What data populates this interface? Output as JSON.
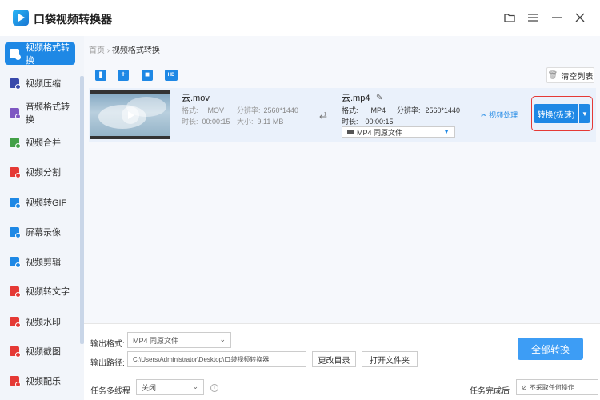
{
  "app": {
    "title": "口袋视频转换器"
  },
  "window_controls": {
    "folder": "folder-icon",
    "menu": "menu-icon",
    "minimize": "minimize-icon",
    "close": "close-icon"
  },
  "sidebar": {
    "items": [
      {
        "label": "视频格式转换",
        "color": "#1e88e5"
      },
      {
        "label": "视频压缩",
        "color": "#3949ab"
      },
      {
        "label": "音频格式转换",
        "color": "#7e57c2"
      },
      {
        "label": "视频合并",
        "color": "#43a047"
      },
      {
        "label": "视频分割",
        "color": "#e53935"
      },
      {
        "label": "视频转GIF",
        "color": "#1e88e5"
      },
      {
        "label": "屏幕录像",
        "color": "#1e88e5"
      },
      {
        "label": "视频剪辑",
        "color": "#1e88e5"
      },
      {
        "label": "视频转文字",
        "color": "#e53935"
      },
      {
        "label": "视频水印",
        "color": "#e53935"
      },
      {
        "label": "视频截图",
        "color": "#e53935"
      },
      {
        "label": "视频配乐",
        "color": "#e53935"
      }
    ]
  },
  "breadcrumb": {
    "home": "首页",
    "sep": "›",
    "current": "视频格式转换"
  },
  "toolbar": {
    "clear_label": "清空列表"
  },
  "file": {
    "source_name": "云.mov",
    "source_format_label": "格式:",
    "source_format": "MOV",
    "source_res_label": "分辨率:",
    "source_res": "2560*1440",
    "source_duration_label": "时长:",
    "source_duration": "00:00:15",
    "source_size_label": "大小:",
    "source_size": "9.11 MB",
    "target_name": "云.mp4",
    "target_format_label": "格式:",
    "target_format": "MP4",
    "target_res_label": "分辨率:",
    "target_res": "2560*1440",
    "target_duration_label": "时长:",
    "target_duration": "00:00:15",
    "target_preset": "MP4  同原文件",
    "process_label": "视频处理",
    "convert_label": "转换(极速)"
  },
  "bottom": {
    "output_format_label": "输出格式:",
    "output_format_value": "MP4  同原文件",
    "output_path_label": "输出路径:",
    "output_path_value": "C:\\Users\\Administrator\\Desktop\\口袋视频转换器",
    "change_dir_label": "更改目录",
    "open_folder_label": "打开文件夹",
    "convert_all_label": "全部转换",
    "multithread_label": "任务多线程",
    "multithread_value": "关闭",
    "after_done_label": "任务完成后",
    "after_done_value": "不采取任何操作"
  }
}
